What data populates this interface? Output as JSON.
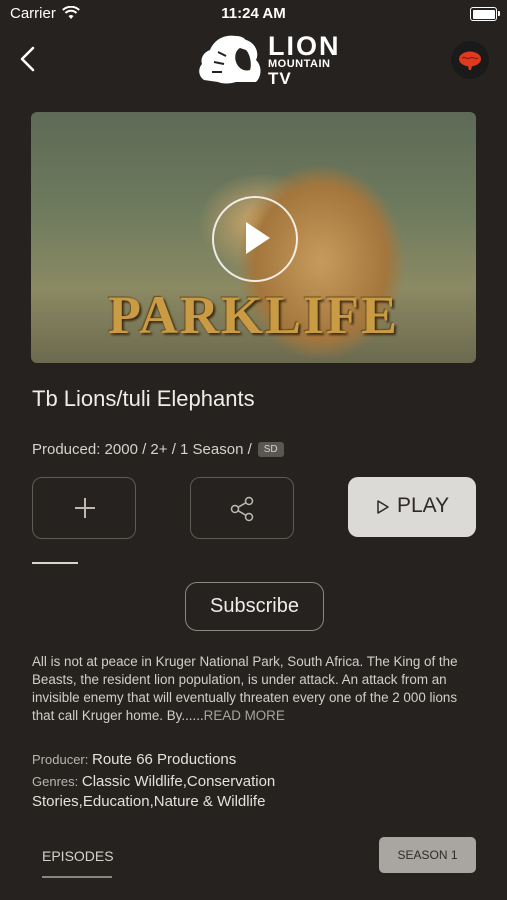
{
  "status_bar": {
    "carrier": "Carrier",
    "time": "11:24 AM"
  },
  "header": {
    "logo_line1": "LION",
    "logo_line2": "MOUNTAIN",
    "logo_line3": "TV"
  },
  "hero": {
    "brand_text": "PARKLIFE"
  },
  "show": {
    "title": "Tb Lions/tuli Elephants",
    "meta": "Produced: 2000 / 2+ / 1 Season /",
    "quality_badge": "SD",
    "play_label": "PLAY",
    "subscribe_label": "Subscribe",
    "description": "All is not at peace in Kruger National Park, South Africa. The King of the Beasts, the resident lion population, is under attack. An attack from an invisible enemy that will eventually threaten every one of the 2 000 lions that call Kruger home. By......",
    "read_more": "READ MORE",
    "producer_label": "Producer:",
    "producer_value": "Route 66 Productions",
    "genres_label": "Genres:",
    "genres_value": "Classic Wildlife,Conservation Stories,Education,Nature & Wildlife"
  },
  "episodes": {
    "tab_label": "EPISODES",
    "season_label": "SEASON 1"
  }
}
